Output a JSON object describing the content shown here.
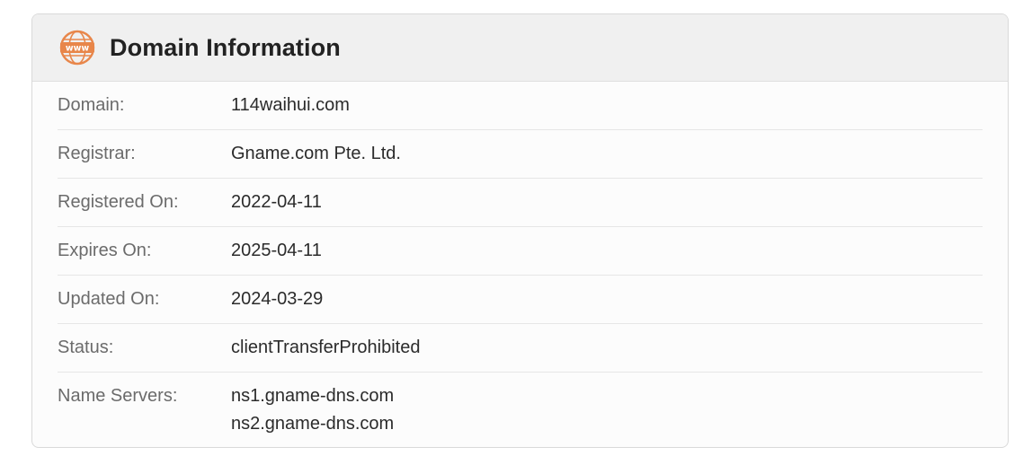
{
  "card": {
    "title": "Domain Information",
    "icon": "www-globe-icon",
    "icon_text": "www",
    "accent_color": "#e8864a"
  },
  "rows": [
    {
      "label": "Domain:",
      "value": "114waihui.com"
    },
    {
      "label": "Registrar:",
      "value": "Gname.com Pte. Ltd."
    },
    {
      "label": "Registered On:",
      "value": "2022-04-11"
    },
    {
      "label": "Expires On:",
      "value": "2025-04-11"
    },
    {
      "label": "Updated On:",
      "value": "2024-03-29"
    },
    {
      "label": "Status:",
      "value": "clientTransferProhibited"
    }
  ],
  "name_servers": {
    "label": "Name Servers:",
    "values": [
      "ns1.gname-dns.com",
      "ns2.gname-dns.com"
    ]
  }
}
